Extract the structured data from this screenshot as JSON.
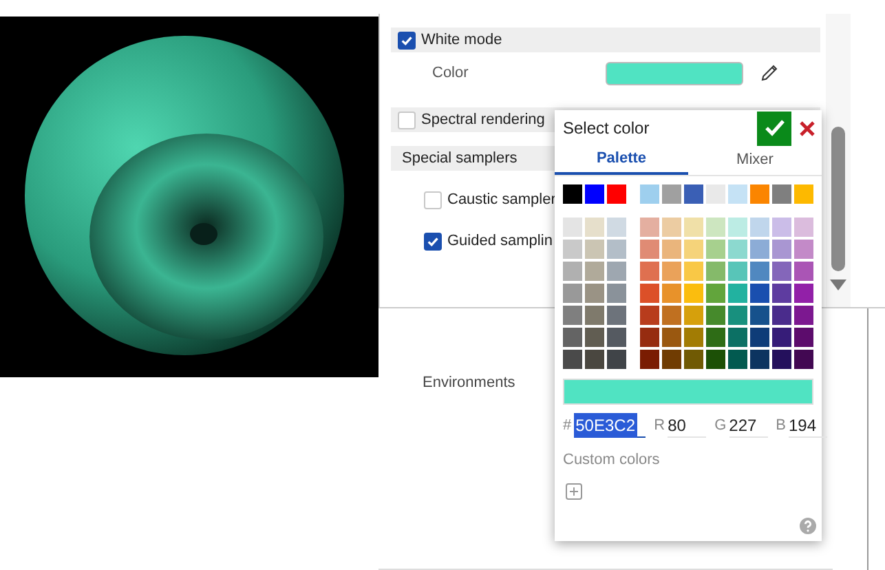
{
  "settings": {
    "rows": [
      {
        "kind": "section",
        "label": "White mode",
        "checked": true
      },
      {
        "kind": "color",
        "label": "Color",
        "color": "#50e3c2"
      },
      {
        "kind": "section",
        "label": "Spectral rendering",
        "checked": false
      },
      {
        "kind": "header",
        "label": "Special samplers"
      },
      {
        "kind": "option",
        "label": "Caustic sampler",
        "checked": false
      },
      {
        "kind": "option",
        "label": "Guided samplin",
        "checked": true
      }
    ]
  },
  "bottom_tabs": [
    {
      "label": "Environments",
      "selected": false
    }
  ],
  "color_picker": {
    "title": "Select color",
    "tabs": [
      {
        "label": "Palette",
        "selected": true
      },
      {
        "label": "Mixer",
        "selected": false
      }
    ],
    "basic_left": [
      {
        "color": "#000000"
      },
      {
        "color": "#0000ff"
      },
      {
        "color": "#ff0000"
      }
    ],
    "basic_right": [
      {
        "color": "#9ecfee"
      },
      {
        "color": "#a0a0a0"
      },
      {
        "color": "#3a5fb5"
      },
      {
        "color": "#e9e9e9"
      },
      {
        "color": "#c5e2f5"
      },
      {
        "color": "#fb8500"
      },
      {
        "color": "#7f7f7f"
      },
      {
        "color": "#fdb900"
      }
    ],
    "grey_rows": [
      [
        {
          "color": "#e4e4e4"
        },
        {
          "color": "#e6dfcb"
        },
        {
          "color": "#d0dae3"
        }
      ],
      [
        {
          "color": "#c9c9c9"
        },
        {
          "color": "#cbc5b3"
        },
        {
          "color": "#b3bec8"
        }
      ],
      [
        {
          "color": "#b0b0b0"
        },
        {
          "color": "#b0aa9a"
        },
        {
          "color": "#9ea7b0"
        }
      ],
      [
        {
          "color": "#999999"
        },
        {
          "color": "#9a9385"
        },
        {
          "color": "#8a929a"
        }
      ],
      [
        {
          "color": "#7f7f7f"
        },
        {
          "color": "#7f7a6c"
        },
        {
          "color": "#6d737b"
        }
      ],
      [
        {
          "color": "#646464"
        },
        {
          "color": "#615d52"
        },
        {
          "color": "#555a61"
        }
      ],
      [
        {
          "color": "#4a4a4a"
        },
        {
          "color": "#4a4740"
        },
        {
          "color": "#404448"
        }
      ]
    ],
    "color_rows": [
      [
        {
          "color": "#e4afa0"
        },
        {
          "color": "#eccca2"
        },
        {
          "color": "#f0e0a8"
        },
        {
          "color": "#cde6c0"
        },
        {
          "color": "#bcece4"
        },
        {
          "color": "#c0d6ec"
        },
        {
          "color": "#cbbde8"
        },
        {
          "color": "#dbbcdd"
        }
      ],
      [
        {
          "color": "#e08b74"
        },
        {
          "color": "#eab57c"
        },
        {
          "color": "#f5d37a"
        },
        {
          "color": "#a7d08e"
        },
        {
          "color": "#8cd9cf"
        },
        {
          "color": "#8cacd6"
        },
        {
          "color": "#a996d2"
        },
        {
          "color": "#c38ac8"
        }
      ],
      [
        {
          "color": "#df7050"
        },
        {
          "color": "#eaa25a"
        },
        {
          "color": "#f9c846"
        },
        {
          "color": "#85ba6a"
        },
        {
          "color": "#58c5b8"
        },
        {
          "color": "#5088c0"
        },
        {
          "color": "#8466ba"
        },
        {
          "color": "#aa55b5"
        }
      ],
      [
        {
          "color": "#dc5028"
        },
        {
          "color": "#e8922a"
        },
        {
          "color": "#fbbd0e"
        },
        {
          "color": "#62a53c"
        },
        {
          "color": "#22b2a0"
        },
        {
          "color": "#1a4faf"
        },
        {
          "color": "#5e3ca0"
        },
        {
          "color": "#9220a8"
        }
      ],
      [
        {
          "color": "#b83c1c"
        },
        {
          "color": "#c07020"
        },
        {
          "color": "#d6a00c"
        },
        {
          "color": "#468a2c"
        },
        {
          "color": "#18907e"
        },
        {
          "color": "#16518c"
        },
        {
          "color": "#4a2c8c"
        },
        {
          "color": "#7c1890"
        }
      ],
      [
        {
          "color": "#962c10"
        },
        {
          "color": "#9a5810"
        },
        {
          "color": "#a27c04"
        },
        {
          "color": "#2e6c16"
        },
        {
          "color": "#0c7064"
        },
        {
          "color": "#0e3c78"
        },
        {
          "color": "#361c78"
        },
        {
          "color": "#5c0c6c"
        }
      ],
      [
        {
          "color": "#7a1c02"
        },
        {
          "color": "#703c02"
        },
        {
          "color": "#705a04"
        },
        {
          "color": "#1c5006"
        },
        {
          "color": "#025a50"
        },
        {
          "color": "#0c3460"
        },
        {
          "color": "#24105c"
        },
        {
          "color": "#420852"
        }
      ]
    ],
    "preview": {
      "color": "#50e3c2"
    },
    "fields": [
      {
        "kind": "hex",
        "label": "#",
        "value": "50E3C2"
      },
      {
        "kind": "channel",
        "label": "R",
        "value": "80"
      },
      {
        "kind": "channel",
        "label": "G",
        "value": "227"
      },
      {
        "kind": "channel",
        "label": "B",
        "value": "194"
      }
    ],
    "custom_colors_label": "Custom colors"
  }
}
